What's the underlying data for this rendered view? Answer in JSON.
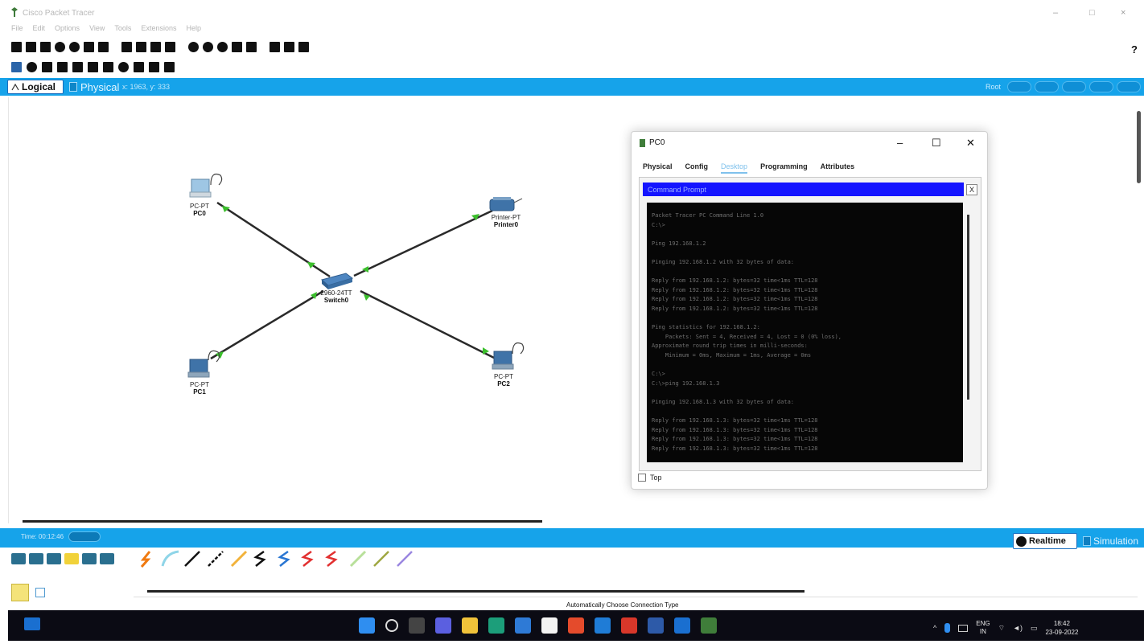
{
  "window": {
    "title": "Cisco Packet Tracer",
    "controls": {
      "minimize": "–",
      "maximize": "□",
      "close": "×"
    }
  },
  "menu": [
    "File",
    "Edit",
    "Options",
    "View",
    "Tools",
    "Extensions",
    "Help"
  ],
  "help_label": "?",
  "workspace_tabs": {
    "logical": "Logical",
    "physical": "Physical",
    "coords": "x: 1963, y: 333",
    "root": "Root"
  },
  "topology": {
    "nodes": [
      {
        "id": "pc0",
        "model": "PC-PT",
        "name": "PC0"
      },
      {
        "id": "pc1",
        "model": "PC-PT",
        "name": "PC1"
      },
      {
        "id": "pc2",
        "model": "PC-PT",
        "name": "PC2"
      },
      {
        "id": "printer0",
        "model": "Printer-PT",
        "name": "Printer0"
      },
      {
        "id": "switch0",
        "model": "2960-24TT",
        "name": "Switch0"
      }
    ],
    "link_color": "#2a2a2a",
    "port_up_color": "#3bbf2c"
  },
  "pc0_dialog": {
    "title": "PC0",
    "controls": {
      "minimize": "–",
      "maximize": "☐",
      "close": "✕"
    },
    "tabs": [
      "Physical",
      "Config",
      "Desktop",
      "Programming",
      "Attributes"
    ],
    "active_tab": "Desktop",
    "app_title": "Command Prompt",
    "close_app": "X",
    "terminal_lines": [
      "Packet Tracer PC Command Line 1.0",
      "C:\\>",
      "",
      "Ping 192.168.1.2",
      "",
      "Pinging 192.168.1.2 with 32 bytes of data:",
      "",
      "Reply from 192.168.1.2: bytes=32 time<1ms TTL=128",
      "Reply from 192.168.1.2: bytes=32 time<1ms TTL=128",
      "Reply from 192.168.1.2: bytes=32 time<1ms TTL=128",
      "Reply from 192.168.1.2: bytes=32 time<1ms TTL=128",
      "",
      "Ping statistics for 192.168.1.2:",
      "    Packets: Sent = 4, Received = 4, Lost = 0 (0% loss),",
      "Approximate round trip times in milli-seconds:",
      "    Minimum = 0ms, Maximum = 1ms, Average = 0ms",
      "",
      "C:\\>",
      "C:\\>ping 192.168.1.3",
      "",
      "Pinging 192.168.1.3 with 32 bytes of data:",
      "",
      "Reply from 192.168.1.3: bytes=32 time<1ms TTL=128",
      "Reply from 192.168.1.3: bytes=32 time<1ms TTL=128",
      "Reply from 192.168.1.3: bytes=32 time<1ms TTL=128",
      "Reply from 192.168.1.3: bytes=32 time<1ms TTL=128"
    ],
    "top_checkbox": "Top"
  },
  "bottom_bar": {
    "time": "Time: 00:12:46",
    "realtime": "Realtime",
    "simulation": "Simulation",
    "connection_hint": "Automatically Choose Connection Type"
  },
  "taskbar": {
    "lang_top": "ENG",
    "lang_bottom": "IN",
    "time": "18:42",
    "date": "23-09-2022"
  }
}
